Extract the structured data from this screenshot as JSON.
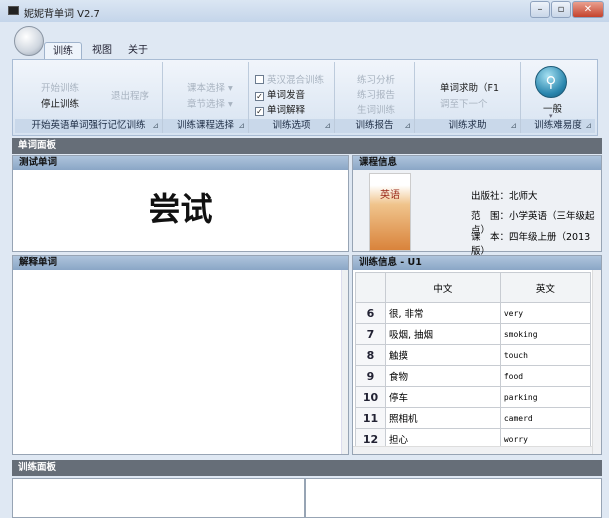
{
  "window": {
    "title": "妮妮背单词 V2.7",
    "min": "–",
    "max": "▫",
    "close": "✕"
  },
  "tabs": [
    "训练",
    "视图",
    "关于"
  ],
  "ribbon": {
    "g1": {
      "label": "开始英语单词强行记忆训练",
      "start": "开始训练",
      "stop": "停止训练",
      "exit": "退出程序"
    },
    "g2": {
      "label": "训练课程选择",
      "book": "课本选择 ▾",
      "chapter": "章节选择 ▾"
    },
    "g3": {
      "label": "训练选项",
      "mix": "英汉混合训练",
      "sound": "单词发音",
      "explain": "单词解释",
      "mix_checked": false,
      "sound_checked": true,
      "explain_checked": true
    },
    "g4": {
      "label": "训练报告",
      "analysis": "练习分析",
      "report": "练习报告",
      "newwords": "生词训练"
    },
    "g5": {
      "label": "训练求助",
      "help": "单词求助（F1",
      "next": "调至下一个"
    },
    "g6": {
      "label": "训练难易度",
      "level": "一般",
      "arrow": "▾"
    }
  },
  "word_panel": {
    "title": "单词面板",
    "test": {
      "title": "测试单词",
      "word": "尝试"
    },
    "explain": {
      "title": "解释单词"
    },
    "course": {
      "title": "课程信息",
      "cover_title": "英语",
      "publisher": "出版社：北师大",
      "range": "范　围：小学英语（三年级起点）",
      "book": "课　本：四年级上册（2013版）"
    },
    "training": {
      "title": "训练信息 - U1",
      "col_cn": "中文",
      "col_en": "英文",
      "rows": [
        [
          "6",
          "很, 非常",
          "very"
        ],
        [
          "7",
          "吸烟, 抽烟",
          "smoking"
        ],
        [
          "8",
          "触摸",
          "touch"
        ],
        [
          "9",
          "食物",
          "food"
        ],
        [
          "10",
          "停车",
          "parking"
        ],
        [
          "11",
          "照相机",
          "camerd"
        ],
        [
          "12",
          "担心",
          "worry"
        ]
      ]
    }
  },
  "train_panel": {
    "title": "训练面板"
  }
}
